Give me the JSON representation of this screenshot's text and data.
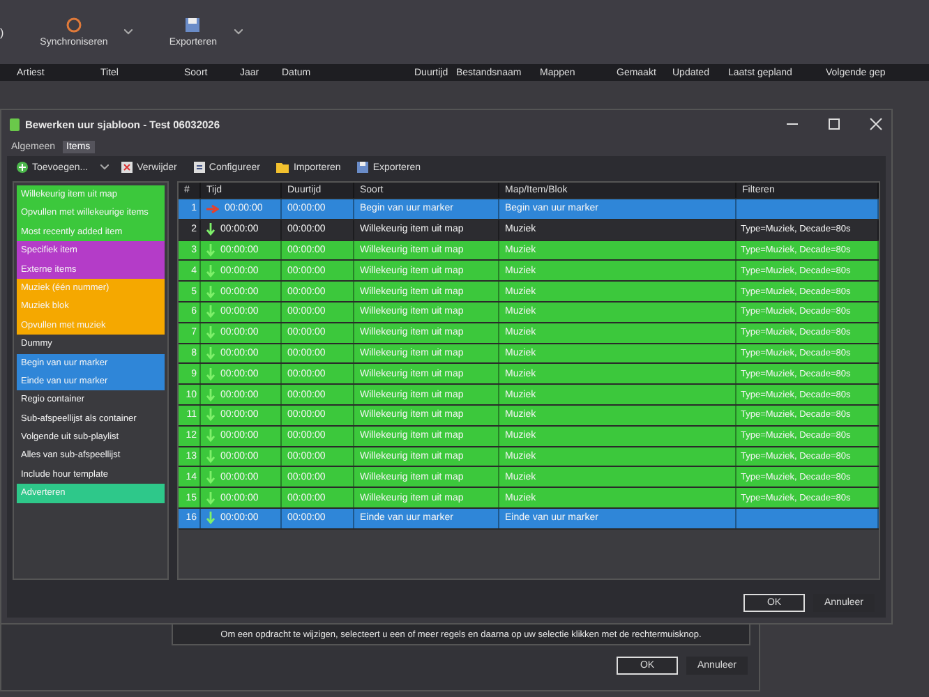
{
  "app": {
    "toolbar": [
      {
        "label": ")",
        "kind": "text"
      },
      {
        "label": "Synchroniseren",
        "kind": "sync"
      },
      {
        "label": "Exporteren",
        "kind": "export"
      }
    ],
    "columns": [
      "Artiest",
      "Titel",
      "Soort",
      "Jaar",
      "Datum",
      "Duurtijd",
      "Bestandsnaam",
      "Mappen",
      "Gemaakt",
      "Updated",
      "Laatst gepland",
      "Volgende gep"
    ]
  },
  "dialog": {
    "title": "Bewerken uur sjabloon - Test 06032026",
    "tabs": [
      {
        "label": "Algemeen",
        "selected": false
      },
      {
        "label": "Items",
        "selected": true
      }
    ],
    "toolbar": [
      {
        "label": "Toevoegen...",
        "kind": "add"
      },
      {
        "label": "Verwijder",
        "kind": "delete"
      },
      {
        "label": "Configureer",
        "kind": "config"
      },
      {
        "label": "Importeren",
        "kind": "folder"
      },
      {
        "label": "Exporteren",
        "kind": "save"
      }
    ],
    "palette": [
      {
        "label": "Willekeurig item uit map",
        "color": "#3cc83c"
      },
      {
        "label": "Opvullen met willekeurige items",
        "color": "#3cc83c"
      },
      {
        "label": "Most recently added item",
        "color": "#3cc83c"
      },
      {
        "label": "Specifiek item",
        "color": "#b43cc8"
      },
      {
        "label": "Externe items",
        "color": "#b43cc8"
      },
      {
        "label": "Muziek (één nummer)",
        "color": "#f5a800"
      },
      {
        "label": "Muziek blok",
        "color": "#f5a800"
      },
      {
        "label": "Opvullen met muziek",
        "color": "#f5a800"
      },
      {
        "label": "Dummy",
        "color": "#3a3a3e"
      },
      {
        "label": "Begin van uur marker",
        "color": "#2f86d8"
      },
      {
        "label": "Einde van uur marker",
        "color": "#2f86d8"
      },
      {
        "label": "Regio container",
        "color": "#3a3a3e"
      },
      {
        "label": "Sub-afspeellijst als container",
        "color": "#3a3a3e"
      },
      {
        "label": "Volgende uit sub-playlist",
        "color": "#3a3a3e"
      },
      {
        "label": "Alles van sub-afspeellijst",
        "color": "#3a3a3e"
      },
      {
        "label": "Include hour template",
        "color": "#3a3a3e"
      },
      {
        "label": "Adverteren",
        "color": "#2ec88a"
      }
    ],
    "columns": [
      "#",
      "Tijd",
      "Duurtijd",
      "Soort",
      "Map/Item/Blok",
      "Filteren"
    ],
    "rows": [
      {
        "n": "1",
        "time": "00:00:00",
        "dur": "00:00:00",
        "type": "Begin van uur marker",
        "map": "Begin van uur marker",
        "kind": "begin_marker",
        "selected": false
      },
      {
        "n": "2",
        "time": "00:00:00",
        "dur": "00:00:00",
        "type": "Willekeurig item uit map",
        "map": "Muziek",
        "filter": "Type=Muziek, Decade=80s",
        "kind": "random",
        "selected": true
      },
      {
        "n": "3",
        "time": "00:00:00",
        "dur": "00:00:00",
        "type": "Willekeurig item uit map",
        "map": "Muziek",
        "filter": "Type=Muziek, Decade=80s",
        "kind": "random",
        "selected": false
      },
      {
        "n": "4",
        "time": "00:00:00",
        "dur": "00:00:00",
        "type": "Willekeurig item uit map",
        "map": "Muziek",
        "filter": "Type=Muziek, Decade=80s",
        "kind": "random",
        "selected": false
      },
      {
        "n": "5",
        "time": "00:00:00",
        "dur": "00:00:00",
        "type": "Willekeurig item uit map",
        "map": "Muziek",
        "filter": "Type=Muziek, Decade=80s",
        "kind": "random",
        "selected": false
      },
      {
        "n": "6",
        "time": "00:00:00",
        "dur": "00:00:00",
        "type": "Willekeurig item uit map",
        "map": "Muziek",
        "filter": "Type=Muziek, Decade=80s",
        "kind": "random",
        "selected": false
      },
      {
        "n": "7",
        "time": "00:00:00",
        "dur": "00:00:00",
        "type": "Willekeurig item uit map",
        "map": "Muziek",
        "filter": "Type=Muziek, Decade=80s",
        "kind": "random",
        "selected": false
      },
      {
        "n": "8",
        "time": "00:00:00",
        "dur": "00:00:00",
        "type": "Willekeurig item uit map",
        "map": "Muziek",
        "filter": "Type=Muziek, Decade=80s",
        "kind": "random",
        "selected": false
      },
      {
        "n": "9",
        "time": "00:00:00",
        "dur": "00:00:00",
        "type": "Willekeurig item uit map",
        "map": "Muziek",
        "filter": "Type=Muziek, Decade=80s",
        "kind": "random",
        "selected": false
      },
      {
        "n": "10",
        "time": "00:00:00",
        "dur": "00:00:00",
        "type": "Willekeurig item uit map",
        "map": "Muziek",
        "filter": "Type=Muziek, Decade=80s",
        "kind": "random",
        "selected": false
      },
      {
        "n": "11",
        "time": "00:00:00",
        "dur": "00:00:00",
        "type": "Willekeurig item uit map",
        "map": "Muziek",
        "filter": "Type=Muziek, Decade=80s",
        "kind": "random",
        "selected": false
      },
      {
        "n": "12",
        "time": "00:00:00",
        "dur": "00:00:00",
        "type": "Willekeurig item uit map",
        "map": "Muziek",
        "filter": "Type=Muziek, Decade=80s",
        "kind": "random",
        "selected": false
      },
      {
        "n": "13",
        "time": "00:00:00",
        "dur": "00:00:00",
        "type": "Willekeurig item uit map",
        "map": "Muziek",
        "filter": "Type=Muziek, Decade=80s",
        "kind": "random",
        "selected": false
      },
      {
        "n": "14",
        "time": "00:00:00",
        "dur": "00:00:00",
        "type": "Willekeurig item uit map",
        "map": "Muziek",
        "filter": "Type=Muziek, Decade=80s",
        "kind": "random",
        "selected": false
      },
      {
        "n": "15",
        "time": "00:00:00",
        "dur": "00:00:00",
        "type": "Willekeurig item uit map",
        "map": "Muziek",
        "filter": "Type=Muziek, Decade=80s",
        "kind": "random",
        "selected": false
      },
      {
        "n": "16",
        "time": "00:00:00",
        "dur": "00:00:00",
        "type": "Einde van uur marker",
        "map": "Einde van uur marker",
        "kind": "end_marker",
        "selected": false
      }
    ],
    "buttons": [
      {
        "label": "OK",
        "kind": "default"
      },
      {
        "label": "Annuleer",
        "kind": "normal"
      }
    ]
  },
  "back_dialog": {
    "message": "Om een opdracht te wijzigen, selecteert u een of meer regels en daarna op uw selectie klikken met de rechtermuisknop.",
    "buttons": [
      {
        "label": "OK",
        "kind": "default"
      },
      {
        "label": "Annuleer",
        "kind": "normal"
      }
    ]
  }
}
